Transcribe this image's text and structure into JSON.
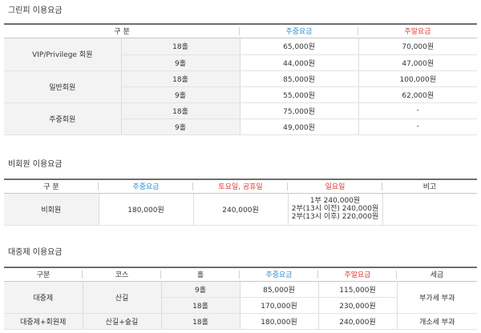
{
  "greenfee": {
    "title": "그린피 이용요금",
    "headers": {
      "category": "구 분",
      "weekday": "주중요금",
      "weekend": "주말요금"
    },
    "rows": [
      {
        "member": "VIP/Privilege 회원",
        "holes": "18홀",
        "weekday": "65,000원",
        "weekend": "70,000원"
      },
      {
        "member": "",
        "holes": "9홀",
        "weekday": "44,000원",
        "weekend": "47,000원"
      },
      {
        "member": "일반회원",
        "holes": "18홀",
        "weekday": "85,000원",
        "weekend": "100,000원"
      },
      {
        "member": "",
        "holes": "9홀",
        "weekday": "55,000원",
        "weekend": "62,000원"
      },
      {
        "member": "주중회원",
        "holes": "18홀",
        "weekday": "75,000원",
        "weekend": "-"
      },
      {
        "member": "",
        "holes": "9홀",
        "weekday": "49,000원",
        "weekend": "-"
      }
    ]
  },
  "nonmember": {
    "title": "비회원 이용요금",
    "headers": {
      "category": "구 분",
      "weekday": "주중요금",
      "saturday": "토요일, 공휴일",
      "sunday": "일요일",
      "note": "비고"
    },
    "row": {
      "label": "비회원",
      "weekday": "180,000원",
      "saturday": "240,000원",
      "sunday_lines": [
        "1부 240,000원",
        "2부(13시 이전) 240,000원",
        "2부(13시 이후) 220,000원"
      ],
      "note": ""
    }
  },
  "public": {
    "title": "대중제 이용요금",
    "headers": {
      "category": "구분",
      "course": "코스",
      "holes": "홀",
      "weekday": "주중요금",
      "weekend": "주말요금",
      "tax": "세금"
    },
    "rows": [
      {
        "category": "대중제",
        "course": "산길",
        "holes": "9홀",
        "weekday": "85,000원",
        "weekend": "115,000원",
        "tax": "부가세 부과"
      },
      {
        "category": "",
        "course": "",
        "holes": "18홀",
        "weekday": "170,000원",
        "weekend": "230,000원",
        "tax": ""
      },
      {
        "category": "대중제+회원제",
        "course": "산길+숲길",
        "holes": "18홀",
        "weekday": "180,000원",
        "weekend": "240,000원",
        "tax": "개소세 부과"
      }
    ]
  }
}
